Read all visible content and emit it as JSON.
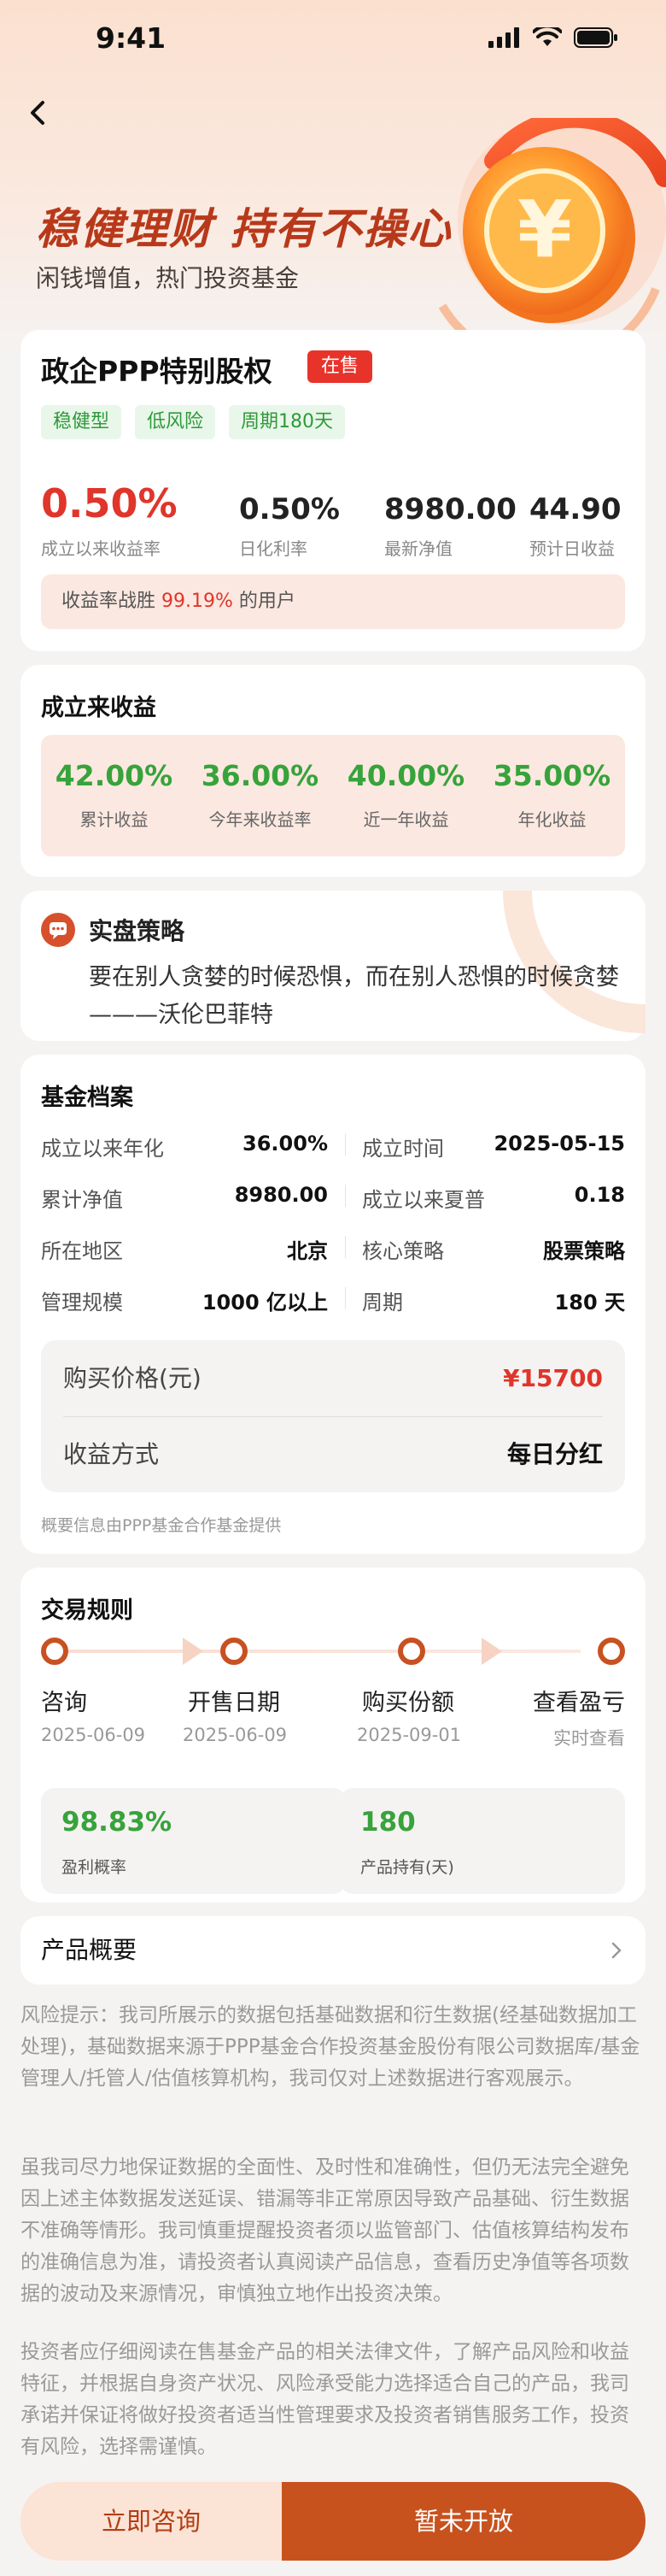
{
  "status_bar": {
    "time": "9:41"
  },
  "hero": {
    "title": "稳健理财 持有不操心",
    "subtitle": "闲钱增值，热门投资基金",
    "coin_symbol": "¥"
  },
  "fund": {
    "name": "政企PPP特别股权",
    "status_badge": "在售",
    "tags": [
      "稳健型",
      "低风险",
      "周期180天"
    ],
    "kpis": [
      {
        "value": "0.50%",
        "label": "成立以来收益率"
      },
      {
        "value": "0.50%",
        "label": "日化利率"
      },
      {
        "value": "8980.00",
        "label": "最新净值"
      },
      {
        "value": "44.90",
        "label": "预计日收益"
      }
    ],
    "win_rate": {
      "prefix": "收益率战胜",
      "percent": "99.19%",
      "suffix": "的用户"
    }
  },
  "returns": {
    "title": "成立来收益",
    "items": [
      {
        "value": "42.00%",
        "label": "累计收益"
      },
      {
        "value": "36.00%",
        "label": "今年来收益率"
      },
      {
        "value": "40.00%",
        "label": "近一年收益"
      },
      {
        "value": "35.00%",
        "label": "年化收益"
      }
    ]
  },
  "strategy": {
    "title": "实盘策略",
    "text": "要在别人贪婪的时候恐惧，而在别人恐惧的时候贪婪———沃伦巴菲特"
  },
  "profile": {
    "title": "基金档案",
    "rows": [
      {
        "k1": "成立以来年化",
        "v1": "36.00%",
        "k2": "成立时间",
        "v2": "2025-05-15"
      },
      {
        "k1": "累计净值",
        "v1": "8980.00",
        "k2": "成立以来夏普",
        "v2": "0.18"
      },
      {
        "k1": "所在地区",
        "v1": "北京",
        "k2": "核心策略",
        "v2": "股票策略"
      },
      {
        "k1": "管理规模",
        "v1": "1000 亿以上",
        "k2": "周期",
        "v2": "180 天"
      }
    ],
    "price_label": "购买价格(元)",
    "price_value": "¥15700",
    "income_label": "收益方式",
    "income_value": "每日分红",
    "source_note": "概要信息由PPP基金合作基金提供"
  },
  "rules": {
    "title": "交易规则",
    "steps": [
      {
        "name": "咨询",
        "date": "2025-06-09"
      },
      {
        "name": "开售日期",
        "date": "2025-06-09"
      },
      {
        "name": "购买份额",
        "date": "2025-09-01"
      },
      {
        "name": "查看盈亏",
        "date": "实时查看"
      }
    ],
    "stats": [
      {
        "value": "98.83%",
        "label": "盈利概率"
      },
      {
        "value": "180",
        "label": "产品持有(天)"
      }
    ]
  },
  "overview": {
    "label": "产品概要"
  },
  "risk": {
    "p1": "风险提示：我司所展示的数据包括基础数据和衍生数据(经基础数据加工处理)，基础数据来源于PPP基金合作投资基金股份有限公司数据库/基金管理人/托管人/估值核算机构，我司仅对上述数据进行客观展示。",
    "p2": "虽我司尽力地保证数据的全面性、及时性和准确性，但仍无法完全避免因上述主体数据发送延误、错漏等非正常原因导致产品基础、衍生数据不准确等情形。我司慎重提醒投资者须以监管部门、估值核算结构发布的准确信息为准，请投资者认真阅读产品信息，查看历史净值等各项数据的波动及来源情况，审慎独立地作出投资决策。",
    "p3": "投资者应仔细阅读在售基金产品的相关法律文件，了解产品风险和收益特征，并根据自身资产状况、风险承受能力选择适合自己的产品，我司承诺并保证将做好投资者适当性管理要求及投资者销售服务工作，投资有风险，选择需谨慎。"
  },
  "actions": {
    "consult": "立即咨询",
    "closed": "暂未开放"
  },
  "colors": {
    "accent": "#c8521e",
    "red": "#e0352a",
    "green": "#37a33b"
  }
}
